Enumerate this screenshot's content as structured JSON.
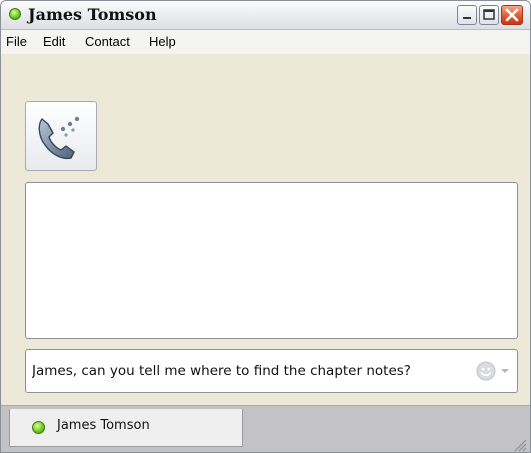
{
  "window": {
    "title": "James Tomson",
    "status": "online",
    "status_color": "#6cc21d"
  },
  "titlebar": {
    "buttons": [
      "minimize",
      "maximize",
      "close"
    ]
  },
  "menu": {
    "items": [
      "File",
      "Edit",
      "Contact",
      "Help"
    ]
  },
  "toolbar": {
    "call_icon": "phone-icon"
  },
  "chat": {
    "history_text": "",
    "compose_value": "James, can you tell me where to find the chapter notes?"
  },
  "emoji": {
    "icon": "smiley-icon"
  },
  "tabs": [
    {
      "label": "James Tomson",
      "status": "online"
    }
  ]
}
